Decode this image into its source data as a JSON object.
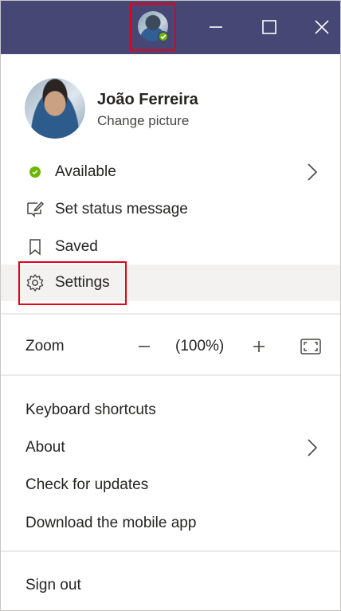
{
  "titlebar": {
    "avatar_icon": "user-avatar-with-available-status",
    "minimize_icon": "minimize-icon",
    "maximize_icon": "maximize-icon",
    "close_icon": "close-icon",
    "background_color": "#464775"
  },
  "profile": {
    "name": "João Ferreira",
    "change_picture": "Change picture"
  },
  "menu": {
    "available": "Available",
    "set_status_message": "Set status message",
    "saved": "Saved",
    "settings": "Settings"
  },
  "zoom": {
    "label": "Zoom",
    "minus": "−",
    "value": "(100%)",
    "plus": "+"
  },
  "links": {
    "keyboard_shortcuts": "Keyboard shortcuts",
    "about": "About",
    "check_for_updates": "Check for updates",
    "download_mobile_app": "Download the mobile app"
  },
  "sign_out": "Sign out",
  "colors": {
    "available_status": "#6bb700",
    "highlight_border": "#e3001b",
    "hover_background": "#f3f2f1"
  }
}
